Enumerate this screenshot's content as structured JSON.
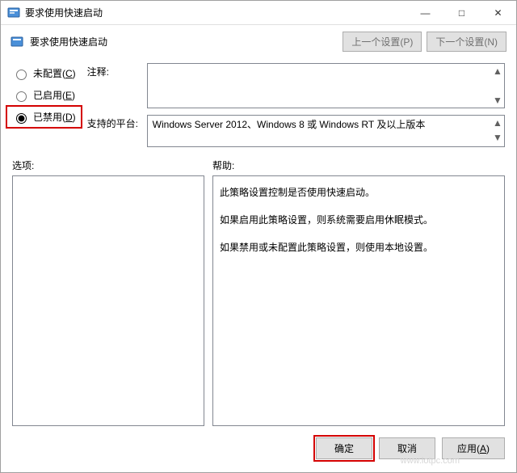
{
  "window": {
    "title": "要求使用快速启动",
    "header_title": "要求使用快速启动"
  },
  "nav": {
    "prev": "上一个设置(P)",
    "next": "下一个设置(N)"
  },
  "radios": {
    "not_configured": "未配置(C)",
    "enabled": "已启用(E)",
    "disabled": "已禁用(D)",
    "selected": "disabled"
  },
  "labels": {
    "comment": "注释:",
    "platform": "支持的平台:",
    "options": "选项:",
    "help": "帮助:"
  },
  "platform_text": "Windows Server 2012、Windows 8 或 Windows RT 及以上版本",
  "help_text": {
    "p1": "此策略设置控制是否使用快速启动。",
    "p2": "如果启用此策略设置，则系统需要启用休眠模式。",
    "p3": "如果禁用或未配置此策略设置，则使用本地设置。"
  },
  "footer": {
    "ok": "确定",
    "cancel": "取消",
    "apply": "应用(A)"
  },
  "win_controls": {
    "minimize": "—",
    "maximize": "□",
    "close": "✕"
  },
  "watermark": "www.lotpc.com"
}
